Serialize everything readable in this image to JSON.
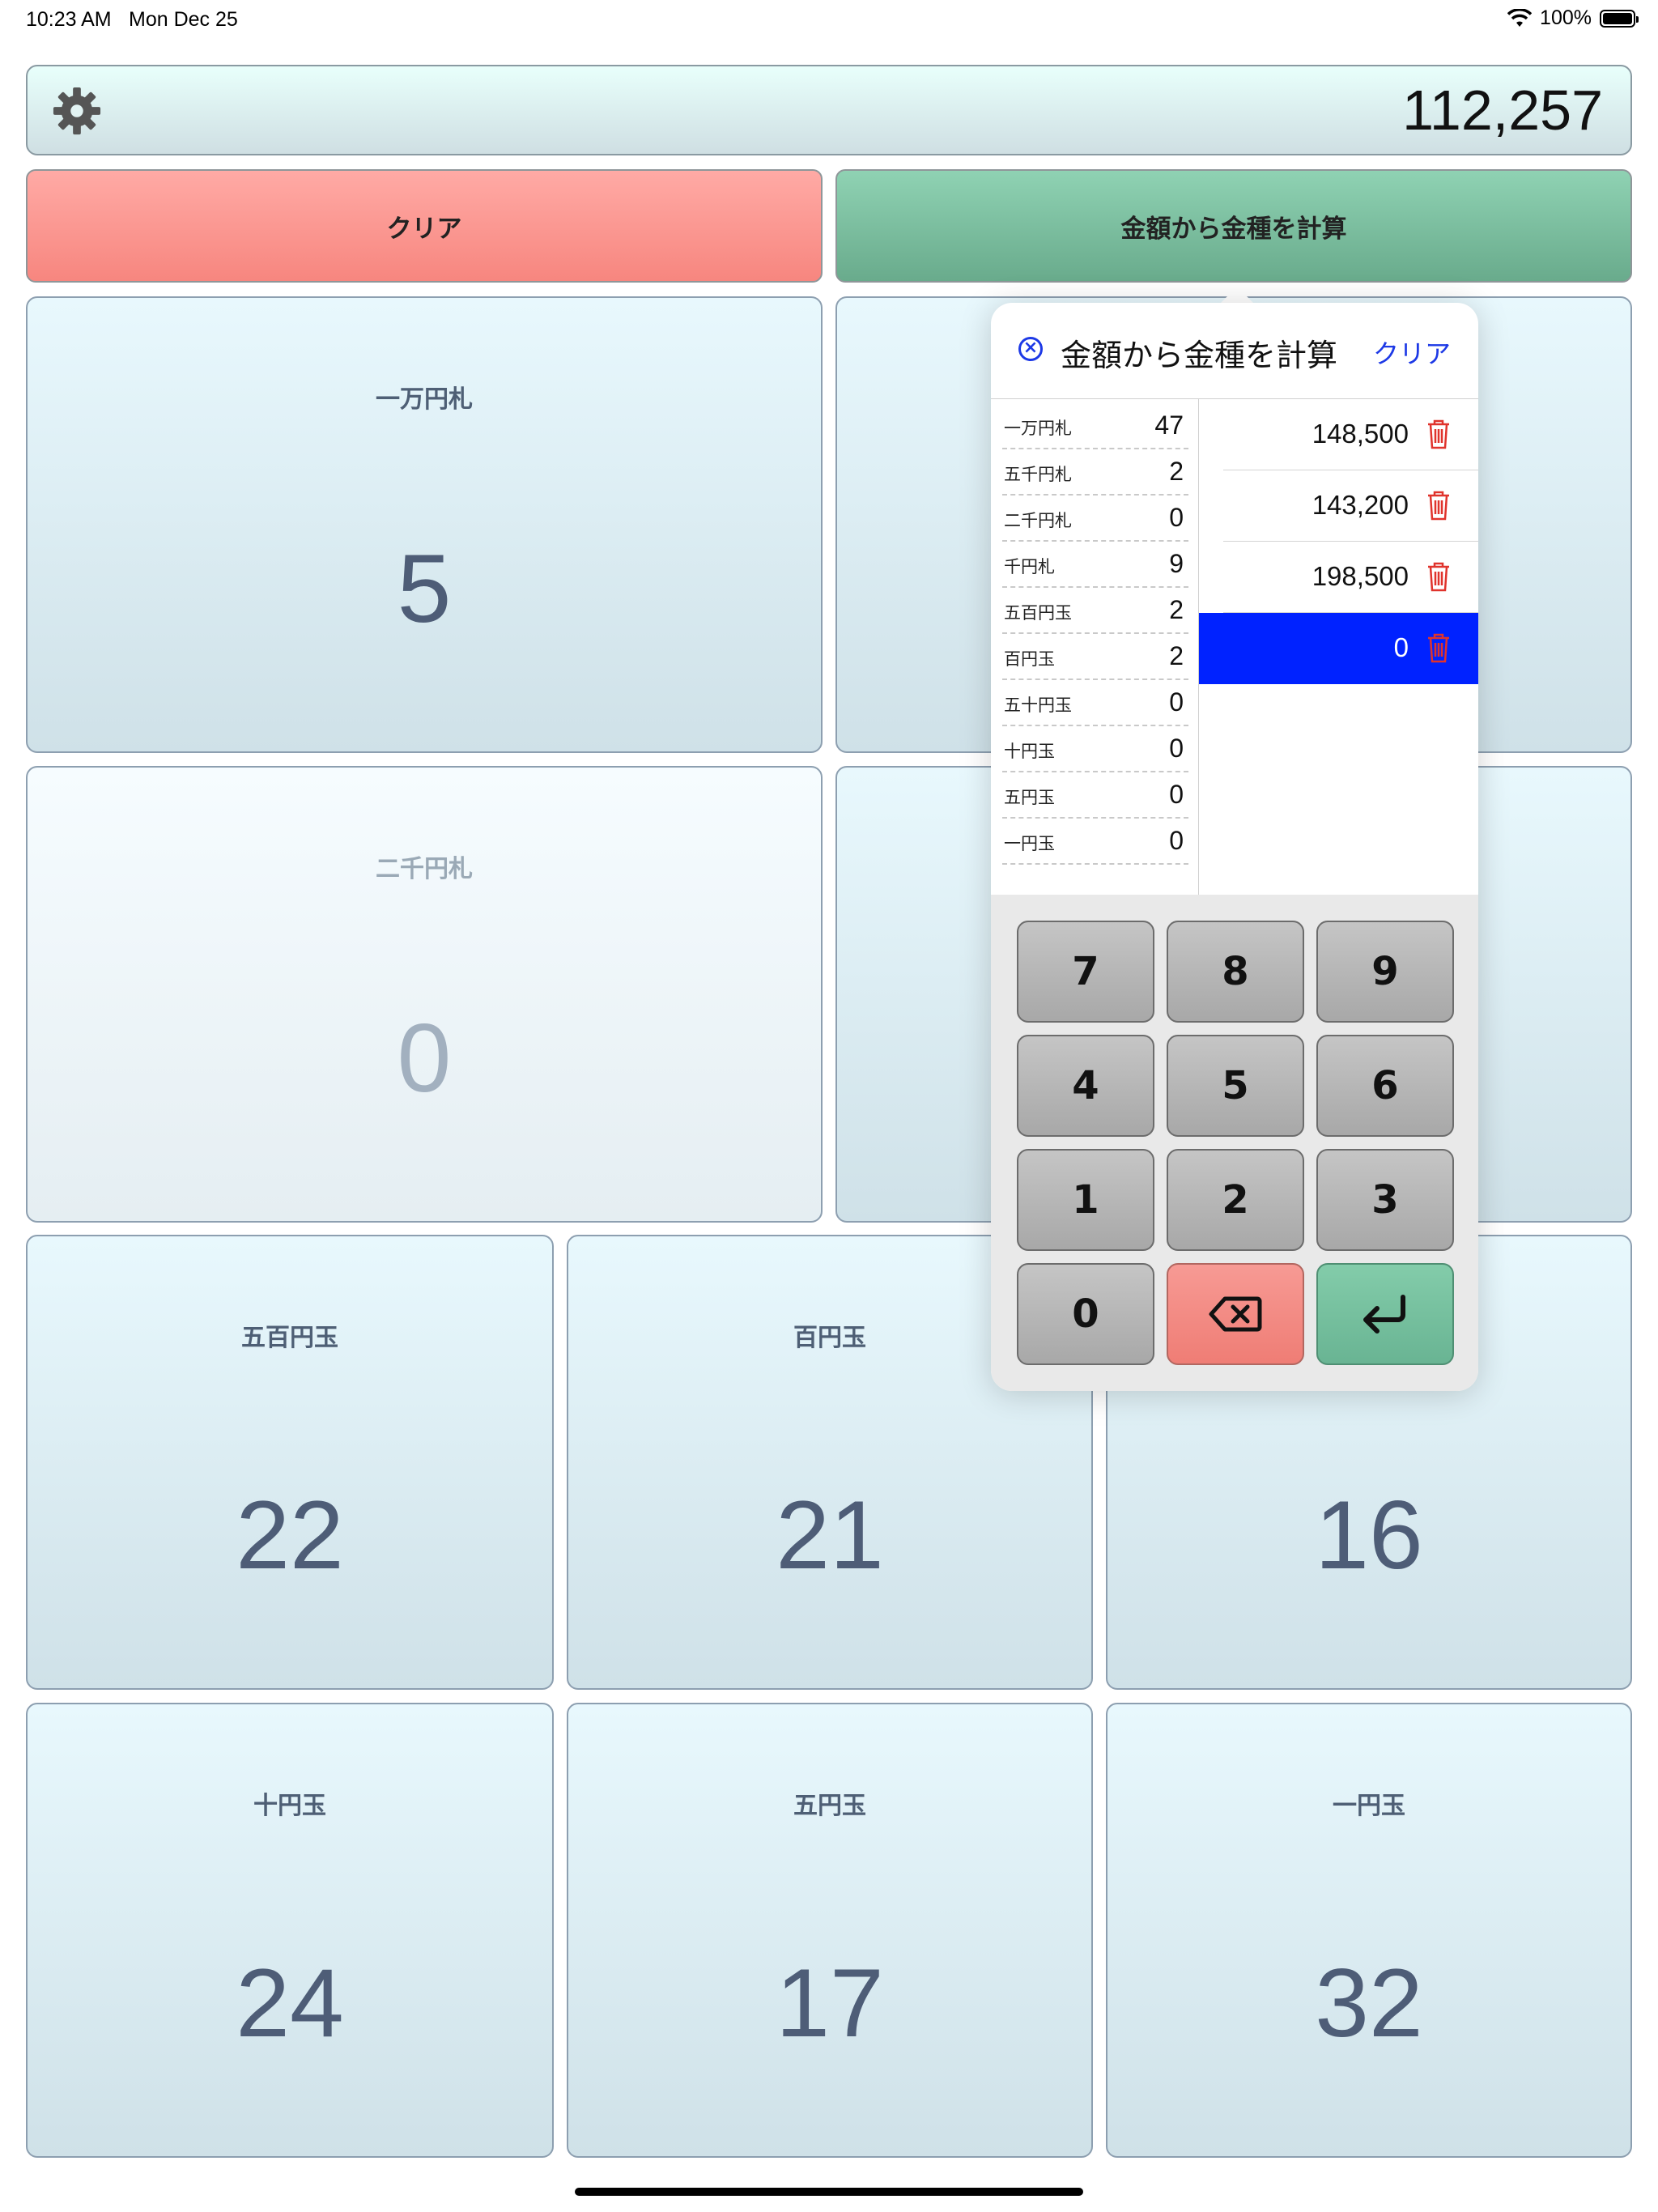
{
  "status_bar": {
    "time": "10:23 AM",
    "date": "Mon Dec 25",
    "battery": "100%"
  },
  "header": {
    "total": "112,257",
    "settings_icon": "gear-icon"
  },
  "actions": {
    "clear_label": "クリア",
    "calc_label": "金額から金種を計算"
  },
  "tiles": [
    {
      "label": "一万円札",
      "value": "5"
    },
    {
      "label": "二千円札",
      "value": "0"
    },
    {
      "label": "五百円玉",
      "value": "22"
    },
    {
      "label": "百円玉",
      "value": "21"
    },
    {
      "label": "",
      "value": "16"
    },
    {
      "label": "十円玉",
      "value": "24"
    },
    {
      "label": "五円玉",
      "value": "17"
    },
    {
      "label": "一円玉",
      "value": "32"
    }
  ],
  "popover": {
    "title": "金額から金種を計算",
    "clear_label": "クリア",
    "close_icon": "close-circle-icon",
    "denominations": [
      {
        "name": "一万円札",
        "count": "47"
      },
      {
        "name": "五千円札",
        "count": "2"
      },
      {
        "name": "二千円札",
        "count": "0"
      },
      {
        "name": "千円札",
        "count": "9"
      },
      {
        "name": "五百円玉",
        "count": "2"
      },
      {
        "name": "百円玉",
        "count": "2"
      },
      {
        "name": "五十円玉",
        "count": "0"
      },
      {
        "name": "十円玉",
        "count": "0"
      },
      {
        "name": "五円玉",
        "count": "0"
      },
      {
        "name": "一円玉",
        "count": "0"
      }
    ],
    "amounts": [
      {
        "value": "148,500",
        "selected": false
      },
      {
        "value": "143,200",
        "selected": false
      },
      {
        "value": "198,500",
        "selected": false
      },
      {
        "value": "0",
        "selected": true
      }
    ],
    "keypad": [
      "7",
      "8",
      "9",
      "4",
      "5",
      "6",
      "1",
      "2",
      "3",
      "0"
    ],
    "keypad_icons": {
      "delete": "backspace-icon",
      "enter": "return-icon"
    },
    "colors": {
      "selected_row": "#0022ff",
      "accent": "#1d39e6",
      "trash": "#e0332c"
    }
  }
}
